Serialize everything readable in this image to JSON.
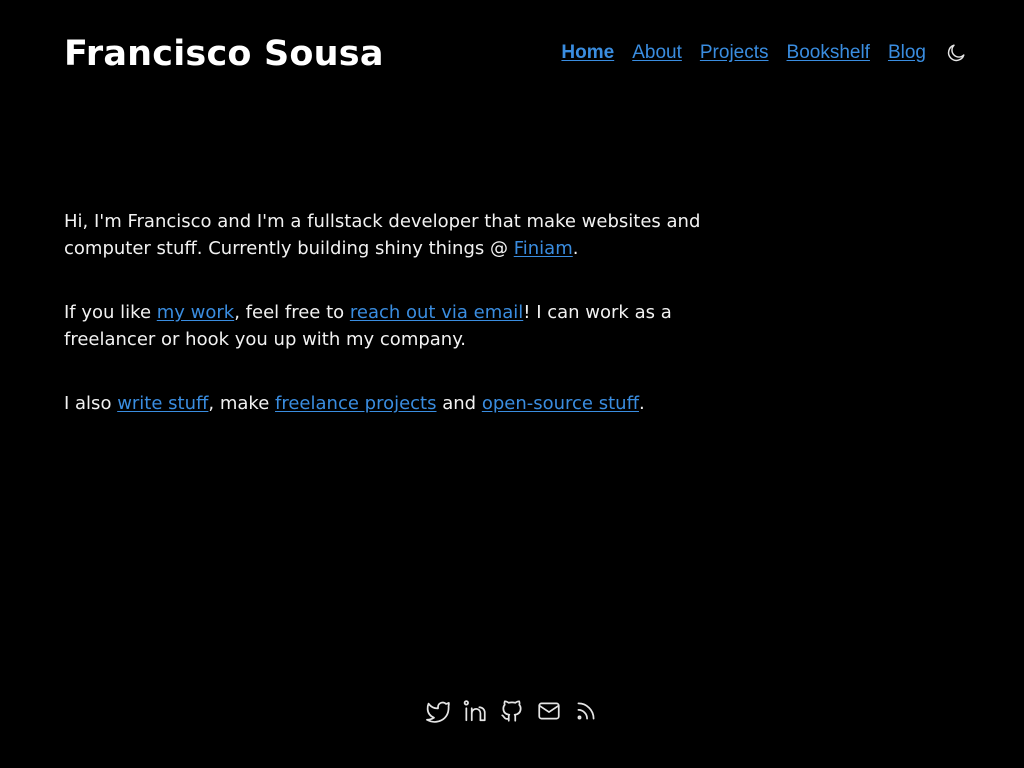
{
  "header": {
    "title": "Francisco Sousa",
    "nav": [
      {
        "label": "Home",
        "active": true
      },
      {
        "label": "About",
        "active": false
      },
      {
        "label": "Projects",
        "active": false
      },
      {
        "label": "Bookshelf",
        "active": false
      },
      {
        "label": "Blog",
        "active": false
      }
    ],
    "theme_toggle_icon": "moon-icon"
  },
  "intro": {
    "p1_text": "Hi, I'm Francisco and I'm a fullstack developer that make websites and computer stuff. Currently building shiny things @ ",
    "p1_link": "Finiam",
    "p1_end": ".",
    "p2_start": "If you like ",
    "p2_link1": "my work",
    "p2_mid": ", feel free to ",
    "p2_link2": "reach out via email",
    "p2_end": "! I can work as a freelancer or hook you up with my company.",
    "p3_start": "I also ",
    "p3_link1": "write stuff",
    "p3_mid1": ", make ",
    "p3_link2": "freelance projects",
    "p3_mid2": " and ",
    "p3_link3": "open-source stuff",
    "p3_end": "."
  },
  "footer": {
    "icons": [
      "twitter-icon",
      "linkedin-icon",
      "github-icon",
      "email-icon",
      "rss-icon"
    ]
  },
  "colors": {
    "background": "#000000",
    "text": "#f2f2f2",
    "link": "#3a8de0"
  }
}
